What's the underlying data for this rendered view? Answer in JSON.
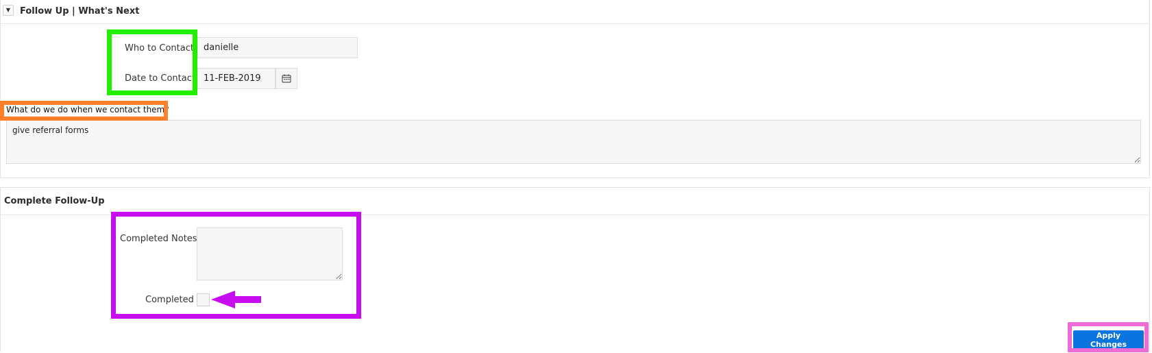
{
  "follow_up": {
    "title": "Follow Up | What's Next",
    "toggle_glyph": "▼",
    "who_label": "Who to Contact:",
    "who_value": "danielle",
    "date_label": "Date to Contact:",
    "date_value": "11-FEB-2019",
    "question_label": "What do we do when we contact them?",
    "question_value": "give referral forms"
  },
  "complete": {
    "title": "Complete Follow-Up",
    "notes_label": "Completed Notes",
    "notes_value": "",
    "completed_label": "Completed",
    "completed_checked": false
  },
  "actions": {
    "apply_label": "Apply Changes"
  },
  "colors": {
    "accent_button": "#0a74df",
    "highlight_green": "#22ee00",
    "highlight_orange": "#ff7f2a",
    "highlight_purple": "#c70df0",
    "highlight_pink": "#ef6bd6"
  },
  "icons": {
    "date_picker": "calendar-icon",
    "arrow": "arrow-left-icon"
  }
}
